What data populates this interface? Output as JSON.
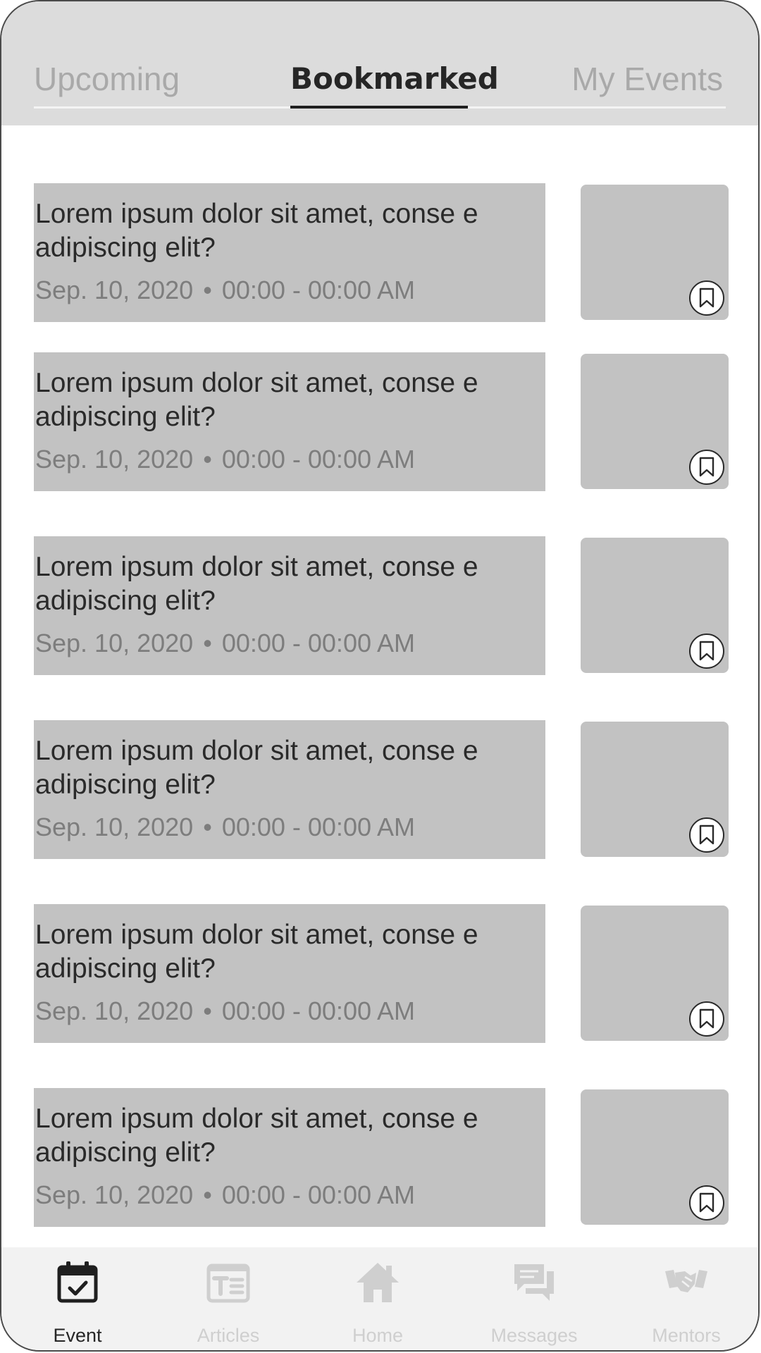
{
  "tabs": {
    "upcoming": "Upcoming",
    "bookmarked": "Bookmarked",
    "my_events": "My Events",
    "active": "Bookmarked"
  },
  "events": [
    {
      "title": "Lorem ipsum dolor sit amet, conse e adipiscing elit?",
      "date": "Sep. 10, 2020",
      "separator": "•",
      "time": "00:00 - 00:00 AM",
      "bookmarked": true
    },
    {
      "title": "Lorem ipsum dolor sit amet, conse e adipiscing elit?",
      "date": "Sep. 10, 2020",
      "separator": "•",
      "time": "00:00 - 00:00 AM",
      "bookmarked": true
    },
    {
      "title": "Lorem ipsum dolor sit amet, conse e adipiscing elit?",
      "date": "Sep. 10, 2020",
      "separator": "•",
      "time": "00:00 - 00:00 AM",
      "bookmarked": true
    },
    {
      "title": "Lorem ipsum dolor sit amet, conse e adipiscing elit?",
      "date": "Sep. 10, 2020",
      "separator": "•",
      "time": "00:00 - 00:00 AM",
      "bookmarked": true
    },
    {
      "title": "Lorem ipsum dolor sit amet, conse e adipiscing elit?",
      "date": "Sep. 10, 2020",
      "separator": "•",
      "time": "00:00 - 00:00 AM",
      "bookmarked": true
    },
    {
      "title": "Lorem ipsum dolor sit amet, conse e adipiscing elit?",
      "date": "Sep. 10, 2020",
      "separator": "•",
      "time": "00:00 - 00:00 AM",
      "bookmarked": true
    }
  ],
  "bottom_nav": [
    {
      "label": "Event",
      "icon": "calendar-check-icon",
      "active": true
    },
    {
      "label": "Articles",
      "icon": "article-icon",
      "active": false
    },
    {
      "label": "Home",
      "icon": "home-icon",
      "active": false
    },
    {
      "label": "Messages",
      "icon": "messages-icon",
      "active": false
    },
    {
      "label": "Mentors",
      "icon": "handshake-icon",
      "active": false
    }
  ],
  "colors": {
    "header_bg": "#dcdcdc",
    "card_bg": "#c2c2c2",
    "active_text": "#262626",
    "inactive_tab": "#a9a9a9",
    "inactive_nav": "#cfcfcf",
    "nav_bg": "#f2f2f2"
  }
}
